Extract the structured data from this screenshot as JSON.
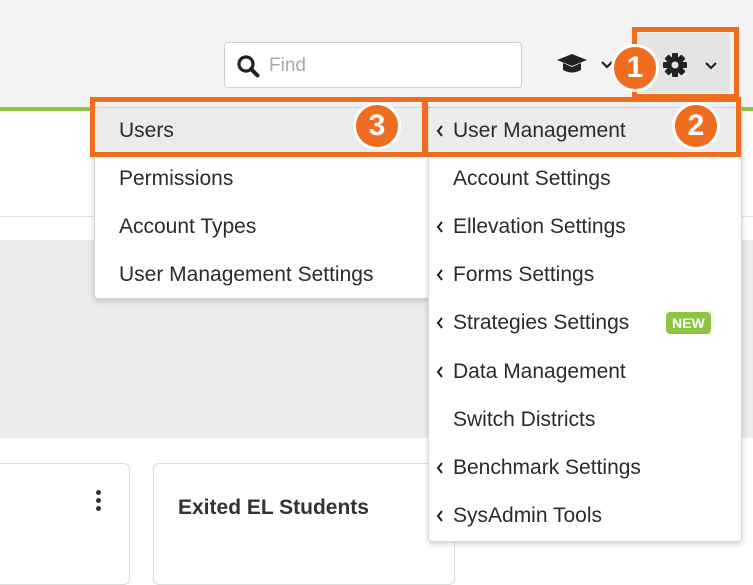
{
  "search": {
    "placeholder": "Find",
    "icon": "search-icon"
  },
  "header": {
    "help_icon": "graduation-cap-icon",
    "settings_icon": "gear-icon",
    "caret_icon": "chevron-down-icon"
  },
  "colors": {
    "accent": "#f06c1f",
    "brand_green": "#8cc63f"
  },
  "cards": {
    "middle_title": "Exited EL Students"
  },
  "user_management_submenu": {
    "items": [
      {
        "label": "Users"
      },
      {
        "label": "Permissions"
      },
      {
        "label": "Account Types"
      },
      {
        "label": "User Management Settings"
      }
    ]
  },
  "settings_menu": {
    "items": [
      {
        "label": "User Management",
        "has_submenu": true
      },
      {
        "label": "Account Settings",
        "has_submenu": false
      },
      {
        "label": "Ellevation Settings",
        "has_submenu": true
      },
      {
        "label": "Forms Settings",
        "has_submenu": true
      },
      {
        "label": "Strategies Settings",
        "has_submenu": true,
        "badge": "NEW"
      },
      {
        "label": "Data Management",
        "has_submenu": true
      },
      {
        "label": "Switch Districts",
        "has_submenu": false
      },
      {
        "label": "Benchmark Settings",
        "has_submenu": true
      },
      {
        "label": "SysAdmin Tools",
        "has_submenu": true
      }
    ]
  },
  "callouts": [
    "1",
    "2",
    "3"
  ]
}
